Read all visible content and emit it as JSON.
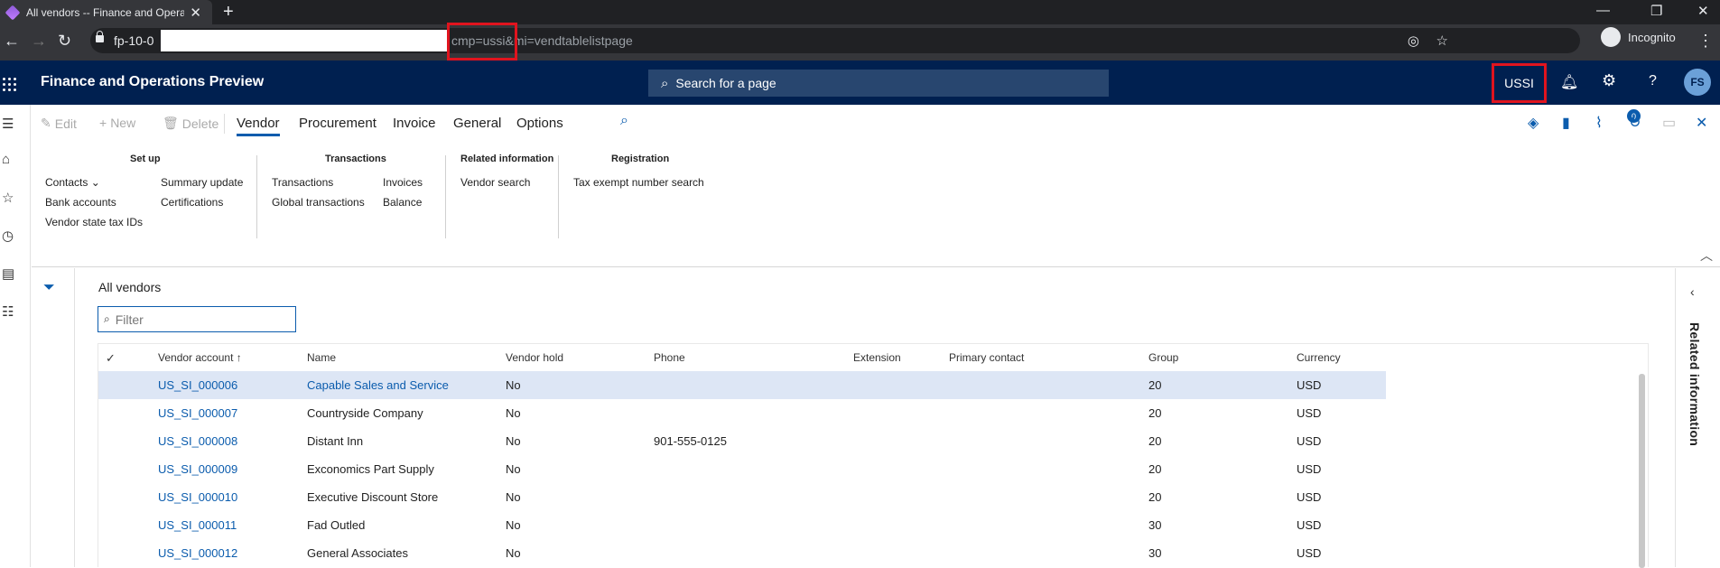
{
  "browser": {
    "tab_title": "All vendors -- Finance and Opera",
    "url_host": "fp-10-0",
    "url_path": "cmp=ussi&mi=vendtablelistpage",
    "profile_label": "Incognito"
  },
  "app": {
    "title": "Finance and Operations Preview",
    "search_placeholder": "Search for a page",
    "company": "USSI",
    "user_initials": "FS"
  },
  "actions": {
    "edit": "Edit",
    "new": "New",
    "delete": "Delete",
    "notification_count": "0"
  },
  "tabs": [
    "Vendor",
    "Procurement",
    "Invoice",
    "General",
    "Options"
  ],
  "ribbon": {
    "setup": {
      "title": "Set up",
      "contacts": "Contacts",
      "bank_accounts": "Bank accounts",
      "vendor_state_tax": "Vendor state tax IDs",
      "summary_update": "Summary update",
      "certifications": "Certifications"
    },
    "transactions": {
      "title": "Transactions",
      "transactions": "Transactions",
      "global_transactions": "Global transactions",
      "invoices": "Invoices",
      "balance": "Balance"
    },
    "related": {
      "title": "Related information",
      "vendor_search": "Vendor search"
    },
    "registration": {
      "title": "Registration",
      "tax_exempt": "Tax exempt number search"
    }
  },
  "page": {
    "title": "All vendors",
    "filter_placeholder": "Filter",
    "right_pane": "Related information"
  },
  "grid": {
    "columns": [
      "Vendor account",
      "Name",
      "Vendor hold",
      "Phone",
      "Extension",
      "Primary contact",
      "Group",
      "Currency"
    ],
    "rows": [
      {
        "account": "US_SI_000006",
        "name": "Capable Sales and Service",
        "hold": "No",
        "phone": "",
        "group": "20",
        "currency": "USD"
      },
      {
        "account": "US_SI_000007",
        "name": "Countryside Company",
        "hold": "No",
        "phone": "",
        "group": "20",
        "currency": "USD"
      },
      {
        "account": "US_SI_000008",
        "name": "Distant Inn",
        "hold": "No",
        "phone": "901-555-0125",
        "group": "20",
        "currency": "USD"
      },
      {
        "account": "US_SI_000009",
        "name": "Exconomics Part Supply",
        "hold": "No",
        "phone": "",
        "group": "20",
        "currency": "USD"
      },
      {
        "account": "US_SI_000010",
        "name": "Executive Discount Store",
        "hold": "No",
        "phone": "",
        "group": "20",
        "currency": "USD"
      },
      {
        "account": "US_SI_000011",
        "name": "Fad Outled",
        "hold": "No",
        "phone": "",
        "group": "30",
        "currency": "USD"
      },
      {
        "account": "US_SI_000012",
        "name": "General Associates",
        "hold": "No",
        "phone": "",
        "group": "30",
        "currency": "USD"
      }
    ]
  }
}
